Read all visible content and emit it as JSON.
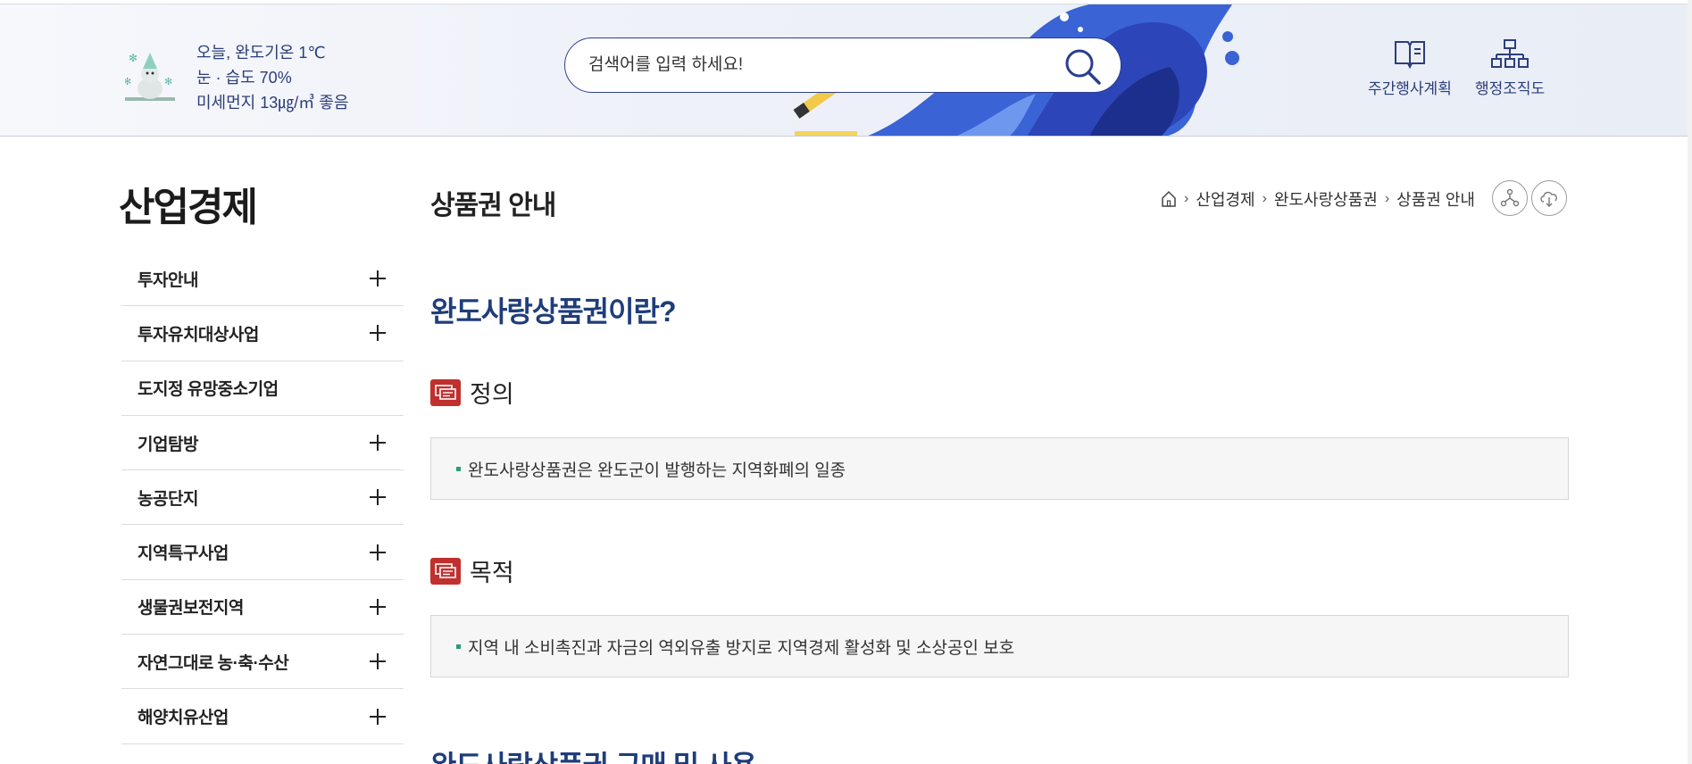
{
  "header": {
    "weather": {
      "line1": "오늘, 완도기온 1℃",
      "line2": "눈 · 습도 70%",
      "line3": "미세먼지 13㎍/㎥ 좋음"
    },
    "search": {
      "placeholder": "검색어를 입력 하세요!"
    },
    "quick_links": [
      {
        "label": "주간행사계획",
        "icon": "book-icon"
      },
      {
        "label": "행정조직도",
        "icon": "org-chart-icon"
      }
    ]
  },
  "sidebar": {
    "title": "산업경제",
    "items": [
      {
        "label": "투자안내",
        "expandable": true
      },
      {
        "label": "투자유치대상사업",
        "expandable": true
      },
      {
        "label": "도지정 유망중소기업",
        "expandable": false
      },
      {
        "label": "기업탐방",
        "expandable": true
      },
      {
        "label": "농공단지",
        "expandable": true
      },
      {
        "label": "지역특구사업",
        "expandable": true
      },
      {
        "label": "생물권보전지역",
        "expandable": true
      },
      {
        "label": "자연그대로 농·축·수산",
        "expandable": true
      },
      {
        "label": "해양치유산업",
        "expandable": true
      }
    ]
  },
  "content": {
    "page_title": "상품권 안내",
    "breadcrumb": [
      "산업경제",
      "완도사랑상품권",
      "상품권 안내"
    ],
    "section1_title": "완도사랑상품권이란?",
    "definition_title": "정의",
    "definition_text": "완도사랑상품권은 완도군이 발행하는 지역화폐의 일종",
    "purpose_title": "목적",
    "purpose_text": "지역 내 소비촉진과 자금의 역외유출 방지로 지역경제 활성화 및 소상공인 보호",
    "section2_title": "완도사랑상품권 구매 및 사용"
  },
  "colors": {
    "accent_navy": "#1f3d7a",
    "badge_red": "#c0302e",
    "bullet_green": "#2c9a7c"
  }
}
